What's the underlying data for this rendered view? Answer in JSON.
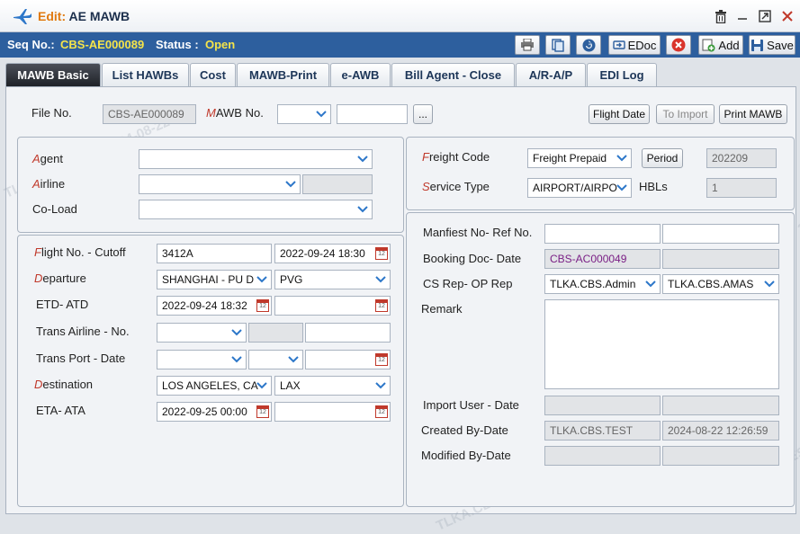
{
  "window": {
    "mode": "Edit",
    "title": "AE MAWB"
  },
  "seq": {
    "label": "Seq No.:",
    "value": "CBS-AE000089",
    "status_label": "Status :",
    "status_value": "Open"
  },
  "toolbar": {
    "edoc": "EDoc",
    "add": "Add",
    "save": "Save"
  },
  "tabs": [
    "MAWB Basic",
    "List HAWBs",
    "Cost",
    "MAWB-Print",
    "e-AWB",
    "Bill Agent - Close",
    "A/R-A/P",
    "EDI Log"
  ],
  "top": {
    "file_no_label": "File No.",
    "file_no": "CBS-AE000089",
    "mawb_label": "MAWB No.",
    "browse": "...",
    "flight_date": "Flight Date",
    "to_import": "To Import",
    "print_mawb": "Print MAWB"
  },
  "left": {
    "agent": "Agent",
    "airline": "Airline",
    "coload": "Co-Load",
    "flight_label": "Flight No. -  Cutoff",
    "flight_no": "3412A",
    "cutoff": "2022-09-24 18:30",
    "departure_label": "Departure",
    "departure": "SHANGHAI - PU D",
    "departure_code": "PVG",
    "etd_label": "ETD- ATD",
    "etd": "2022-09-24 18:32",
    "trans_airline_label": "Trans Airline -  No.",
    "trans_port_label": "Trans Port -  Date",
    "destination_label": "Destination",
    "destination": "LOS ANGELES, CA",
    "destination_code": "LAX",
    "eta_label": "ETA- ATA",
    "eta": "2022-09-25 00:00"
  },
  "right": {
    "freight_code_label": "Freight Code",
    "freight_code": "Freight Prepaid",
    "period_btn": "Period",
    "period": "202209",
    "service_type_label": "Service Type",
    "service_type": "AIRPORT/AIRPO",
    "hbls_label": "HBLs",
    "hbls": "1",
    "manifest_label": "Manfiest No- Ref No.",
    "booking_label": "Booking Doc- Date",
    "booking": "CBS-AC000049",
    "csrep_label": "CS Rep- OP Rep",
    "csrep": "TLKA.CBS.Admin",
    "oprep": "TLKA.CBS.AMAS",
    "remark_label": "Remark",
    "import_user_label": "Import User -  Date",
    "created_label": "Created By-Date",
    "created_by": "TLKA.CBS.TEST",
    "created_date": "2024-08-22 12:26:59",
    "modified_label": "Modified By-Date"
  },
  "watermark": "TLKA.CBS.TEST 2024-08-22",
  "colors": {
    "accent": "#2d5f9e",
    "status": "#f5e44a",
    "required": "#c0392b"
  }
}
